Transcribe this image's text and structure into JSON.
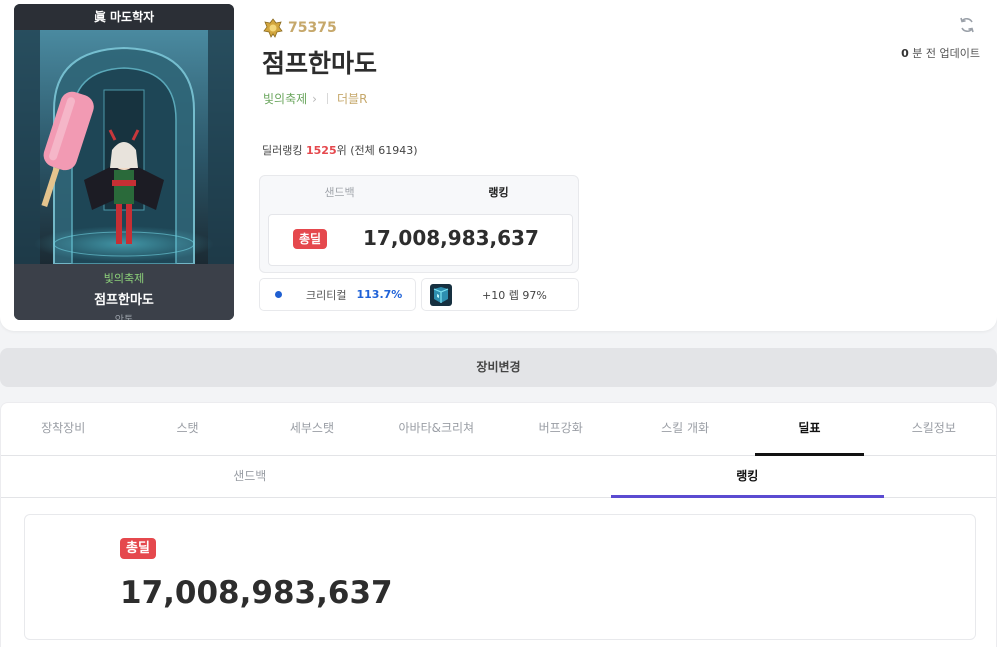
{
  "character": {
    "job_title": "眞 마도학자",
    "guild": "빛의축제",
    "name": "점프한마도",
    "server": "안톤",
    "fame": "75375",
    "adventure": "더블R"
  },
  "header": {
    "update_count": "0",
    "update_label": "분 전 업데이트"
  },
  "ranking": {
    "prefix": "딜러랭킹",
    "rank": "1525",
    "suffix": "위 (전체 61943)"
  },
  "score_panel": {
    "tabs": [
      "샌드백",
      "랭킹"
    ],
    "active_tab": 1,
    "badge": "총딜",
    "value": "17,008,983,637"
  },
  "stats": {
    "crit_label": "크리티컬",
    "crit_value": "113.7%",
    "level_text": "+10 렙 97%"
  },
  "equip_button": "장비변경",
  "main_tabs": [
    "장착장비",
    "스탯",
    "세부스탯",
    "아바타&크리쳐",
    "버프강화",
    "스킬 개화",
    "딜표",
    "스킬정보"
  ],
  "main_active": 6,
  "sub_tabs": [
    "샌드백",
    "랭킹"
  ],
  "sub_active": 1,
  "result": {
    "badge": "총딜",
    "value": "17,008,983,637"
  },
  "colors": {
    "accent_red": "#e5484d",
    "accent_purple": "#5b4bd1",
    "fame_gold": "#c6a86b",
    "guild_green": "#6ba65e",
    "crit_blue": "#1f62d8"
  },
  "icons": {
    "fame": "fame-crest-icon",
    "refresh": "refresh-icon",
    "level": "cube-level-icon",
    "crit": "dot-icon"
  }
}
